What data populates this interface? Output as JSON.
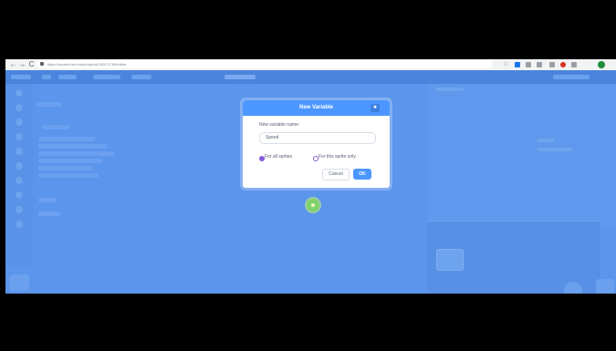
{
  "browser": {
    "url": "https://scratch.mit.edu/projects/340071780/editor",
    "back_label": "←",
    "forward_label": "→",
    "reload_label": "C"
  },
  "dialog": {
    "title": "New Variable",
    "close_label": "✖",
    "field_label": "New variable name:",
    "field_value": "Speed",
    "options": [
      {
        "label": "For all sprites",
        "selected": true
      },
      {
        "label": "For this sprite only",
        "selected": false
      }
    ],
    "cancel_label": "Cancel",
    "ok_label": "OK"
  },
  "colors": {
    "accent": "#4c97ff",
    "overlay": "#5b95ec",
    "radio": "#855cd6"
  }
}
